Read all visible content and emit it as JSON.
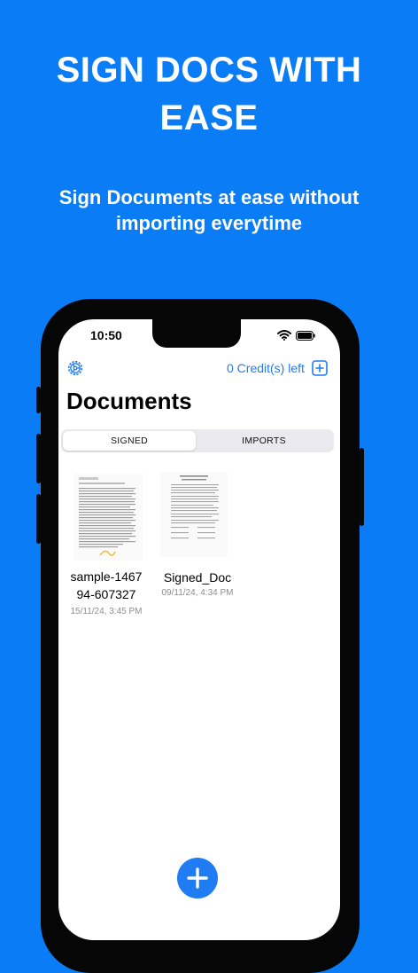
{
  "promo": {
    "headline_line1": "SIGN DOCS WITH",
    "headline_line2": "EASE",
    "subtitle_line1": "Sign Documents at ease without",
    "subtitle_line2": "importing everytime"
  },
  "status_bar": {
    "time": "10:50"
  },
  "header": {
    "credits_label": "0 Credit(s) left",
    "title": "Documents"
  },
  "segments": {
    "signed": "SIGNED",
    "imports": "IMPORTS",
    "selected": "SIGNED"
  },
  "documents": [
    {
      "name_line1": "sample-1467",
      "name_line2": "94-607327",
      "date": "15/11/24, 3:45 PM"
    },
    {
      "name_line1": "Signed_Doc",
      "name_line2": "",
      "date": "09/11/24, 4:34 PM"
    }
  ],
  "icons": {
    "settings": "gear-icon",
    "add_credits": "plus-square-icon",
    "wifi": "wifi-icon",
    "battery": "battery-icon",
    "add_document": "plus-icon"
  },
  "colors": {
    "background": "#0a7cf6",
    "accent": "#1f7cf2",
    "muted": "#8e8e93"
  }
}
